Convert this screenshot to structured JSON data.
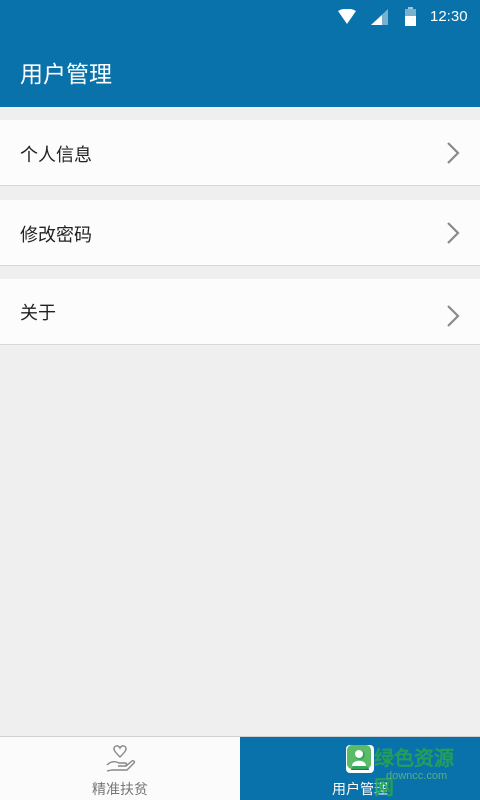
{
  "status_bar": {
    "time": "12:30",
    "icons": [
      "wifi-icon",
      "signal-icon",
      "battery-icon"
    ]
  },
  "header": {
    "title": "用户管理",
    "color": "#0a72aa"
  },
  "menu": {
    "items": [
      {
        "label": "个人信息",
        "icon": "chevron-right-icon"
      },
      {
        "label": "修改密码",
        "icon": "chevron-right-icon"
      },
      {
        "label": "关于",
        "icon": "chevron-right-icon"
      }
    ]
  },
  "tabs": [
    {
      "label": "精准扶贫",
      "icon": "heart-hand-icon",
      "active": false
    },
    {
      "label": "用户管理",
      "icon": "user-icon",
      "active": true
    }
  ],
  "watermark": {
    "text": "绿色资源网",
    "url": "downcc.com"
  }
}
